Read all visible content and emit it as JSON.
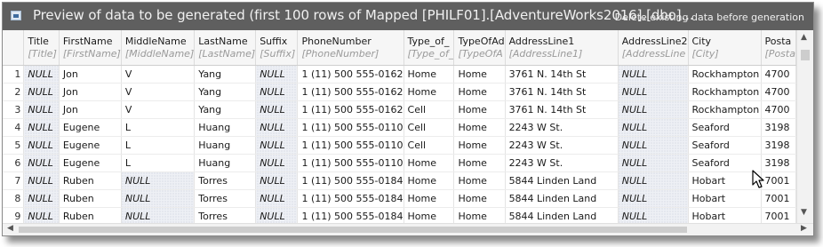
{
  "window": {
    "title": "Preview of data to be generated (first 100 rows of Mapped [PHILF01].[AdventureWorks2016].[dbo]...",
    "option_label": "Delete existing data before generation",
    "icon": "table-icon"
  },
  "columns": [
    {
      "name": "Title",
      "sub": "[Title]"
    },
    {
      "name": "FirstName",
      "sub": "[FirstName]"
    },
    {
      "name": "MiddleName",
      "sub": "[MiddleName]"
    },
    {
      "name": "LastName",
      "sub": "[LastName]"
    },
    {
      "name": "Suffix",
      "sub": "[Suffix]"
    },
    {
      "name": "PhoneNumber",
      "sub": "[PhoneNumber]"
    },
    {
      "name": "Type_of_",
      "sub": "[Type_of_"
    },
    {
      "name": "TypeOfAd",
      "sub": "[TypeOfA"
    },
    {
      "name": "AddressLine1",
      "sub": "[AddressLine1]"
    },
    {
      "name": "AddressLine2",
      "sub": "[AddressLine"
    },
    {
      "name": "City",
      "sub": "[City]"
    },
    {
      "name": "Posta",
      "sub": "[Posta"
    }
  ],
  "rows": [
    {
      "num": "1",
      "cells": [
        "NULL",
        "Jon",
        "V",
        "Yang",
        "NULL",
        "1 (11) 500 555-0162",
        "Home",
        "Home",
        "3761 N. 14th St",
        "NULL",
        "Rockhampton",
        "4700"
      ]
    },
    {
      "num": "2",
      "cells": [
        "NULL",
        "Jon",
        "V",
        "Yang",
        "NULL",
        "1 (11) 500 555-0162",
        "Home",
        "Home",
        "3761 N. 14th St",
        "NULL",
        "Rockhampton",
        "4700"
      ]
    },
    {
      "num": "3",
      "cells": [
        "NULL",
        "Jon",
        "V",
        "Yang",
        "NULL",
        "1 (11) 500 555-0162",
        "Cell",
        "Home",
        "3761 N. 14th St",
        "NULL",
        "Rockhampton",
        "4700"
      ]
    },
    {
      "num": "4",
      "cells": [
        "NULL",
        "Eugene",
        "L",
        "Huang",
        "NULL",
        "1 (11) 500 555-0110",
        "Cell",
        "Home",
        "2243 W St.",
        "NULL",
        "Seaford",
        "3198"
      ]
    },
    {
      "num": "5",
      "cells": [
        "NULL",
        "Eugene",
        "L",
        "Huang",
        "NULL",
        "1 (11) 500 555-0110",
        "Cell",
        "Home",
        "2243 W St.",
        "NULL",
        "Seaford",
        "3198"
      ]
    },
    {
      "num": "6",
      "cells": [
        "NULL",
        "Eugene",
        "L",
        "Huang",
        "NULL",
        "1 (11) 500 555-0110",
        "Home",
        "Home",
        "2243 W St.",
        "NULL",
        "Seaford",
        "3198"
      ]
    },
    {
      "num": "7",
      "cells": [
        "NULL",
        "Ruben",
        "NULL",
        "Torres",
        "NULL",
        "1 (11) 500 555-0184",
        "Home",
        "Home",
        "5844 Linden Land",
        "NULL",
        "Hobart",
        "7001"
      ]
    },
    {
      "num": "8",
      "cells": [
        "NULL",
        "Ruben",
        "NULL",
        "Torres",
        "NULL",
        "1 (11) 500 555-0184",
        "Home",
        "Home",
        "5844 Linden Land",
        "NULL",
        "Hobart",
        "7001"
      ]
    },
    {
      "num": "9",
      "cells": [
        "NULL",
        "Ruben",
        "NULL",
        "Torres",
        "NULL",
        "1 (11) 500 555-0184",
        "Home",
        "Home",
        "5844 Linden Land",
        "NULL",
        "Hobart",
        "7001"
      ]
    }
  ],
  "null_display": "NULL",
  "icons": {
    "scroll_up": "chevron-up-icon",
    "scroll_down": "chevron-down-icon",
    "scroll_left": "chevron-left-icon",
    "scroll_right": "chevron-right-icon",
    "cursor": "mouse-pointer-icon"
  },
  "colors": {
    "titlebar": "#5f5f5f",
    "header_bg": "#f6f6f6",
    "null_bg": "#eef0f5",
    "grid_line": "#e4e4e4"
  }
}
